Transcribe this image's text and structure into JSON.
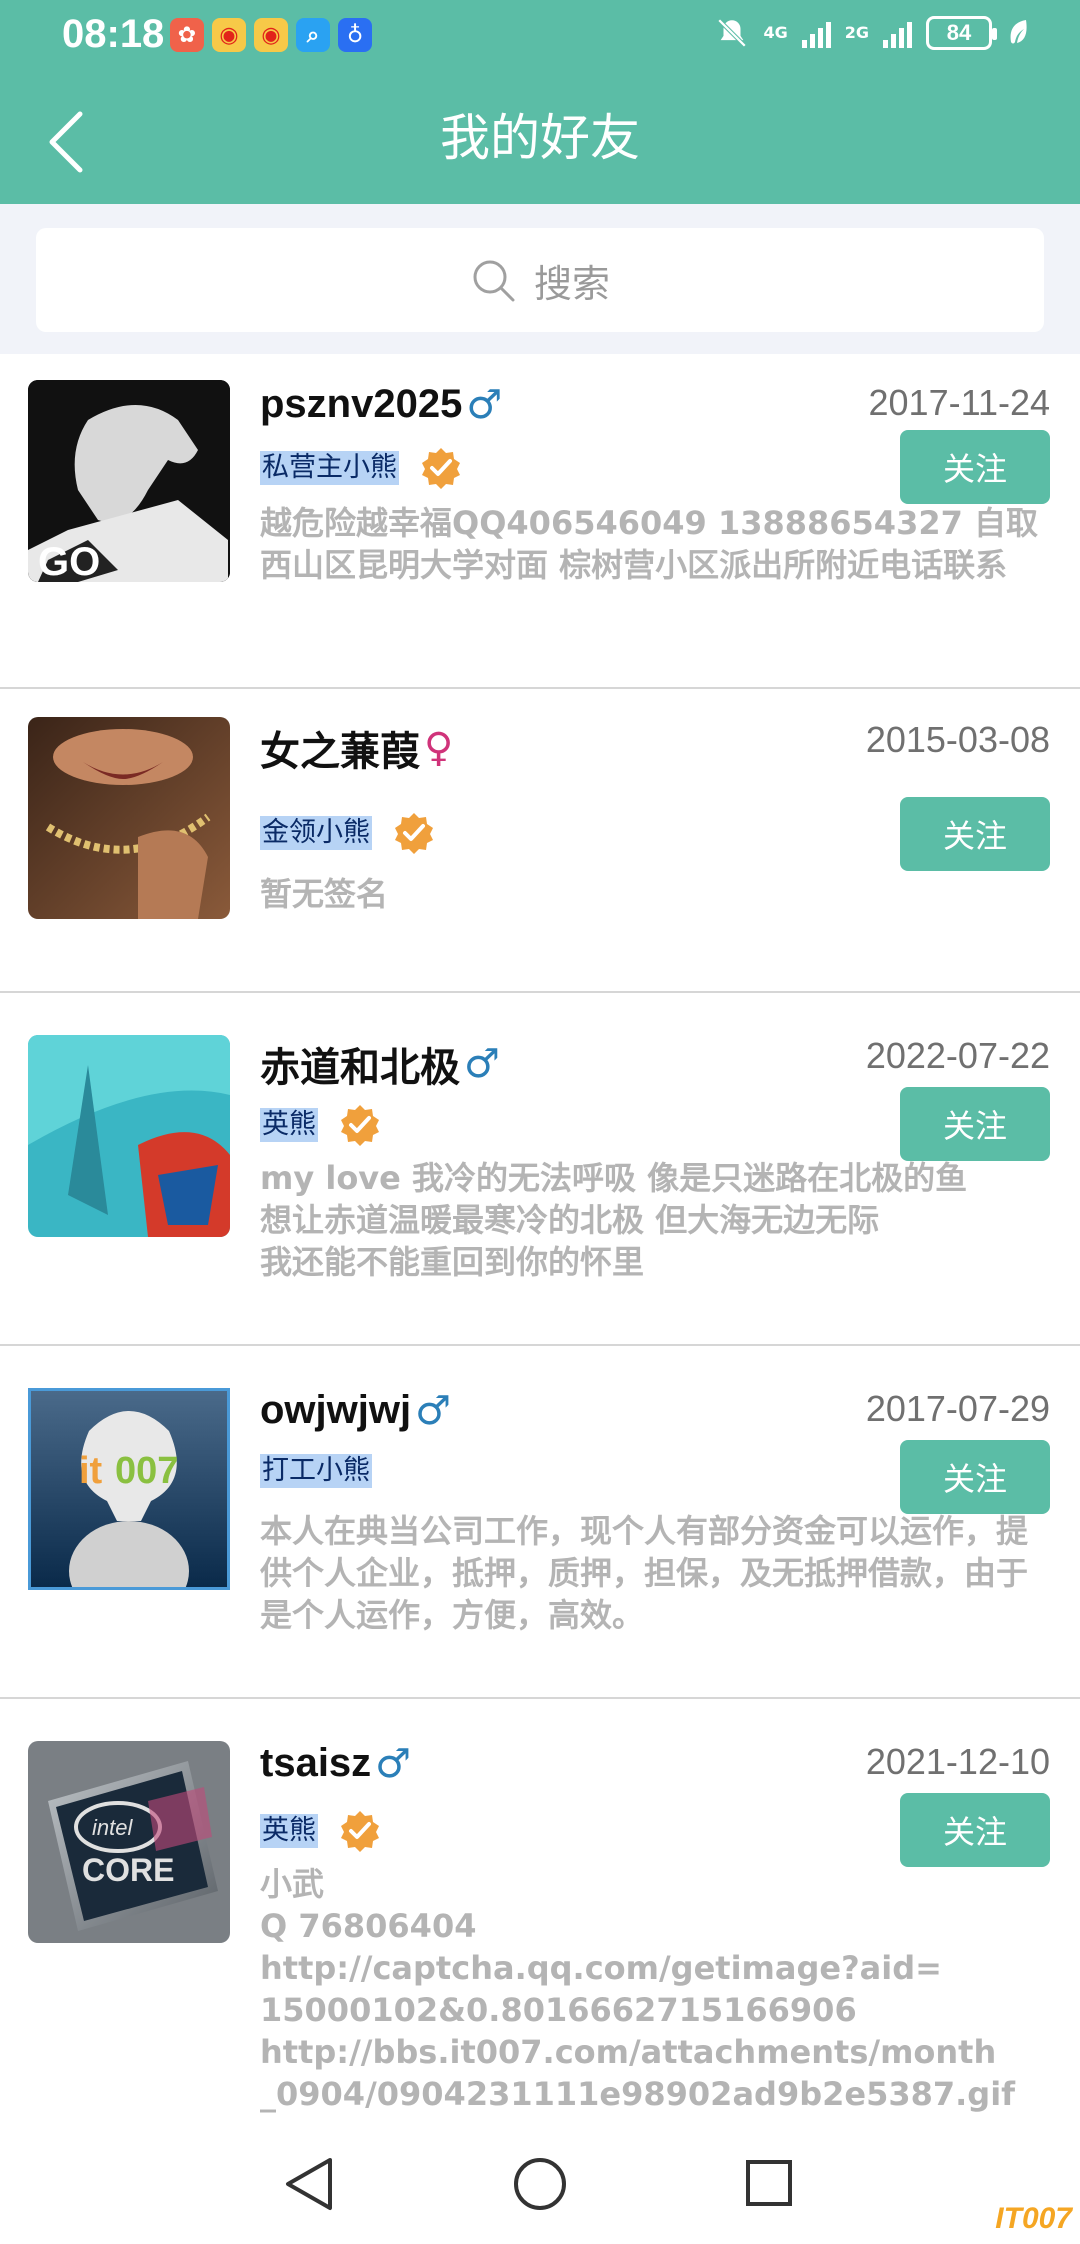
{
  "status_bar": {
    "time": "08:18",
    "network_1": "4G",
    "network_2": "2G",
    "battery": "84",
    "app_icons": [
      "weibo-icon",
      "weibo-icon",
      "weibo-icon",
      "search-app-icon",
      "bulb-app-icon"
    ]
  },
  "header": {
    "title": "我的好友"
  },
  "search": {
    "placeholder": "搜索"
  },
  "friends": [
    {
      "name": "psznv2025",
      "gender": "♂",
      "date": "2017-11-24",
      "level": "私营主小熊",
      "verified": true,
      "follow_label": "关注",
      "signature": "越危险越幸福QQ406546049 13888654327 自取 西山区昆明大学对面 棕树营小区派出所附近电话联系"
    },
    {
      "name": "女之蒹葭",
      "gender": "♀",
      "date": "2015-03-08",
      "level": "金领小熊",
      "verified": true,
      "follow_label": "关注",
      "signature": "暂无签名"
    },
    {
      "name": "赤道和北极",
      "gender": "♂",
      "date": "2022-07-22",
      "level": "英熊",
      "verified": true,
      "follow_label": "关注",
      "signature": "my love 我冷的无法呼吸 像是只迷路在北极的鱼\n想让赤道温暖最寒冷的北极 但大海无边无际\n我还能不能重回到你的怀里"
    },
    {
      "name": "owjwjwj",
      "gender": "♂",
      "date": "2017-07-29",
      "level": "打工小熊",
      "verified": false,
      "follow_label": "关注",
      "signature": "本人在典当公司工作，现个人有部分资金可以运作，提供个人企业，抵押，质押，担保，及无抵押借款，由于是个人运作，方便，高效。"
    },
    {
      "name": "tsaisz",
      "gender": "♂",
      "date": "2021-12-10",
      "level": "英熊",
      "verified": true,
      "follow_label": "关注",
      "signature": "小武\nQ 76806404\nhttp://captcha.qq.com/getimage?aid=\n15000102&0.8016662715166906\nhttp://bbs.it007.com/attachments/month\n_0904/0904231111e98902ad9b2e5387.gif"
    }
  ],
  "watermark": "IT007",
  "colors": {
    "accent": "#5bbda6",
    "verified": "#f0a03c",
    "male": "#2b7fb8",
    "female": "#d0337a"
  }
}
